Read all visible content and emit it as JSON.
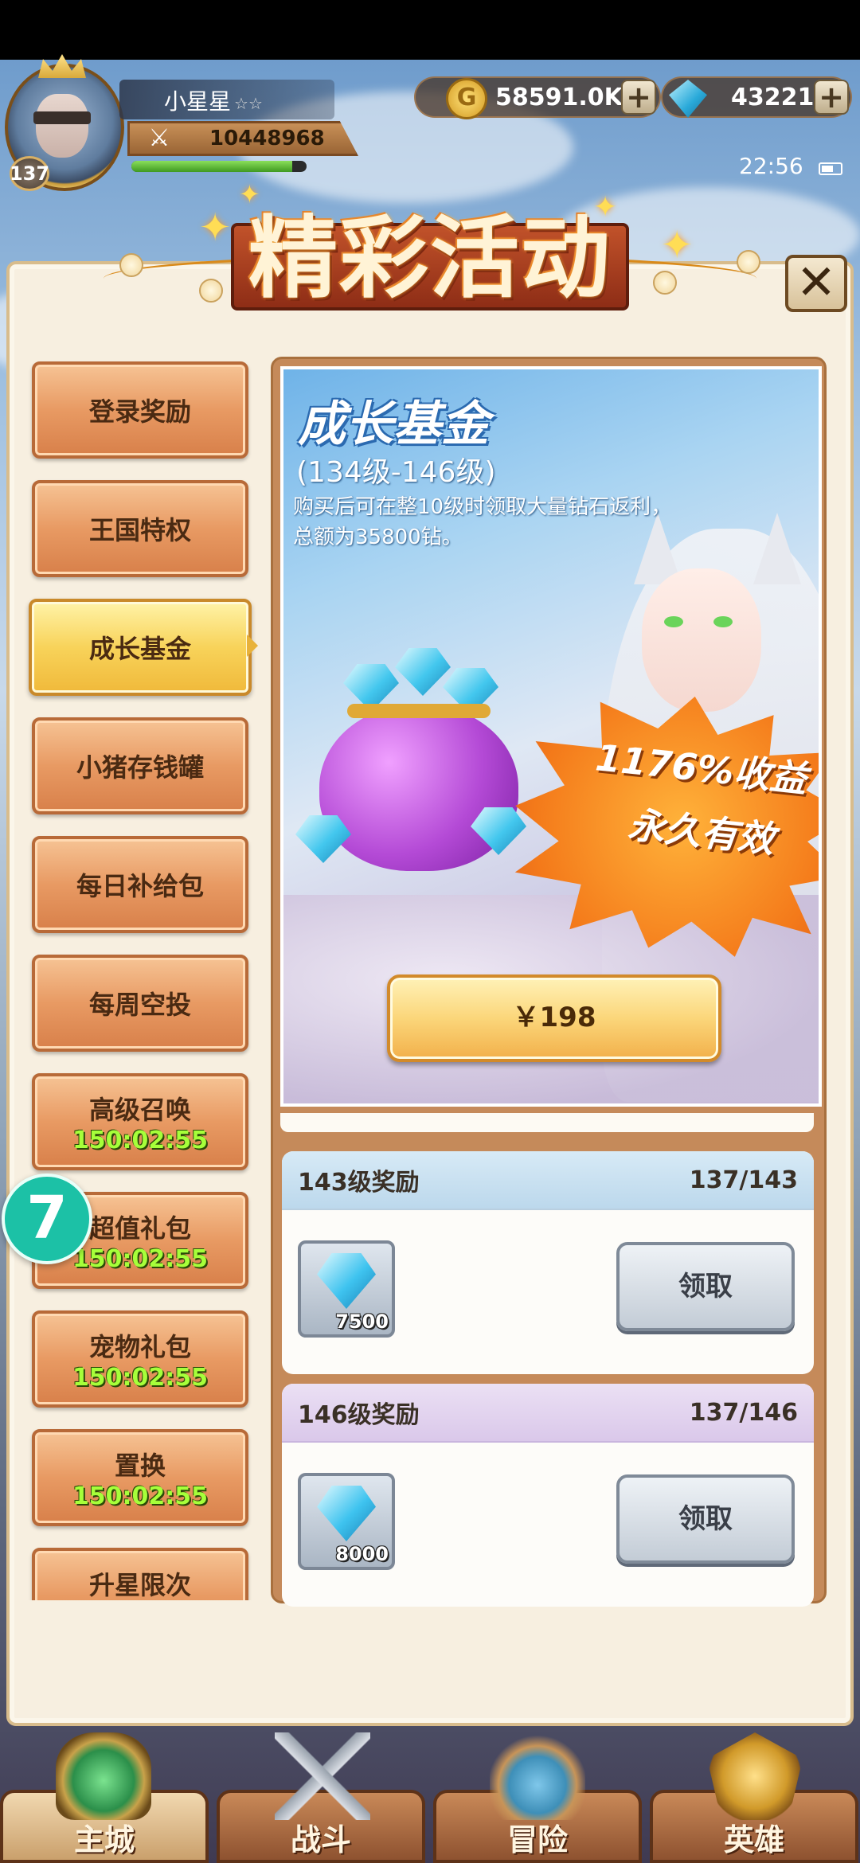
{
  "player": {
    "name": "小星星",
    "stars": "☆☆",
    "level": "137",
    "power": "10448968",
    "xp_progress": 0.92
  },
  "resources": {
    "gold": "58591.0K",
    "gems": "43221",
    "coin_glyph": "G",
    "plus": "+"
  },
  "status": {
    "time": "22:56"
  },
  "title": "精彩活动",
  "close_glyph": "✕",
  "menu": {
    "items": [
      {
        "label": "登录奖励",
        "timer": ""
      },
      {
        "label": "王国特权",
        "timer": ""
      },
      {
        "label": "成长基金",
        "timer": "",
        "active": true
      },
      {
        "label": "小猪存钱罐",
        "timer": ""
      },
      {
        "label": "每日补给包",
        "timer": ""
      },
      {
        "label": "每周空投",
        "timer": ""
      },
      {
        "label": "高级召唤",
        "timer": "150:02:55"
      },
      {
        "label": "超值礼包",
        "timer": "150:02:55"
      },
      {
        "label": "宠物礼包",
        "timer": "150:02:55"
      },
      {
        "label": "置换",
        "timer": "150:02:55"
      },
      {
        "label": "升星限次",
        "timer": ""
      }
    ]
  },
  "promo": {
    "title": "成长基金",
    "range": "(134级-146级)",
    "desc_line1": "购买后可在整10级时领取大量钻石返利，",
    "desc_line2": "总额为35800钻。",
    "burst_line1": "1176%收益",
    "burst_line2": "永久有效",
    "price": "￥198"
  },
  "rewards": [
    {
      "title": "143级奖励",
      "progress": "137/143",
      "count": "7500",
      "claim_label": "领取"
    },
    {
      "title": "146级奖励",
      "progress": "137/146",
      "count": "8000",
      "claim_label": "领取"
    }
  ],
  "floating_badge": "7",
  "bottom_nav": [
    {
      "label": "主城",
      "icon": "castle-icon",
      "active": true
    },
    {
      "label": "战斗",
      "icon": "crossed-swords-icon",
      "active": false
    },
    {
      "label": "冒险",
      "icon": "scroll-map-icon",
      "active": false
    },
    {
      "label": "英雄",
      "icon": "hero-emblem-icon",
      "active": false
    }
  ],
  "colors": {
    "timer_green": "#a6ff3a",
    "menu_orange": "#e89a63",
    "menu_active_gold": "#f8d35a",
    "panel_bg": "#f7efe0",
    "float_teal": "#1cc1a6"
  }
}
